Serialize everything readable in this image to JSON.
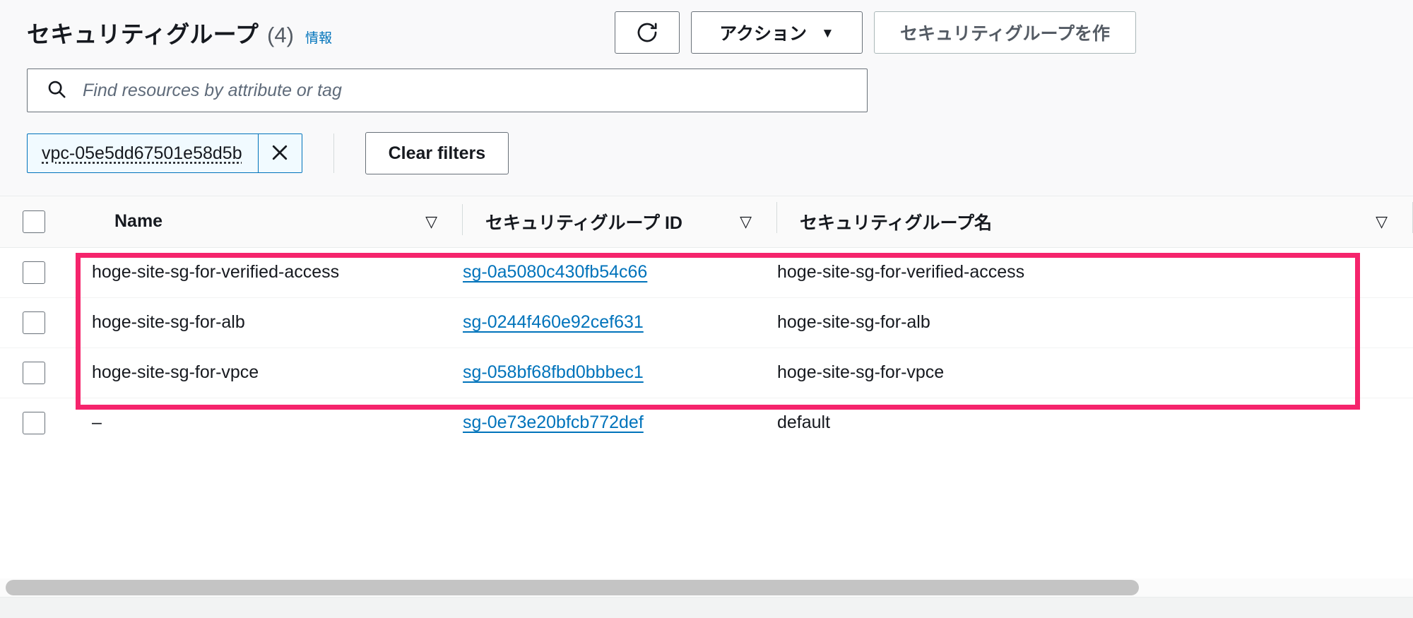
{
  "header": {
    "title": "セキュリティグループ",
    "count": "(4)",
    "info_label": "情報",
    "refresh_icon": "refresh-icon",
    "actions_label": "アクション",
    "actions_caret": "▼",
    "create_label": "セキュリティグループを作"
  },
  "search": {
    "icon": "search-icon",
    "placeholder": "Find resources by attribute or tag",
    "value": ""
  },
  "filters": {
    "token_label": "vpc-05e5dd67501e58d5b",
    "token_dismiss_icon": "close-icon",
    "clear_label": "Clear filters"
  },
  "table": {
    "select_all_name": "select-all-checkbox",
    "columns": [
      {
        "label": "Name",
        "sort_icon": "▽"
      },
      {
        "label": "セキュリティグループ ID",
        "sort_icon": "▽"
      },
      {
        "label": "セキュリティグループ名",
        "sort_icon": "▽"
      }
    ],
    "rows": [
      {
        "name": "hoge-site-sg-for-verified-access",
        "sg_id": "sg-0a5080c430fb54c66",
        "sg_name": "hoge-site-sg-for-verified-access"
      },
      {
        "name": "hoge-site-sg-for-alb",
        "sg_id": "sg-0244f460e92cef631",
        "sg_name": "hoge-site-sg-for-alb"
      },
      {
        "name": "hoge-site-sg-for-vpce",
        "sg_id": "sg-058bf68fbd0bbbec1",
        "sg_name": "hoge-site-sg-for-vpce"
      },
      {
        "name": "–",
        "sg_id": "sg-0e73e20bfcb772def",
        "sg_name": "default"
      }
    ]
  },
  "annotation": {
    "highlight_color": "#f5246c"
  },
  "colors": {
    "link": "#0073bb",
    "text": "#16191f",
    "muted": "#545b64",
    "panel_bg": "#f9f9fa"
  }
}
